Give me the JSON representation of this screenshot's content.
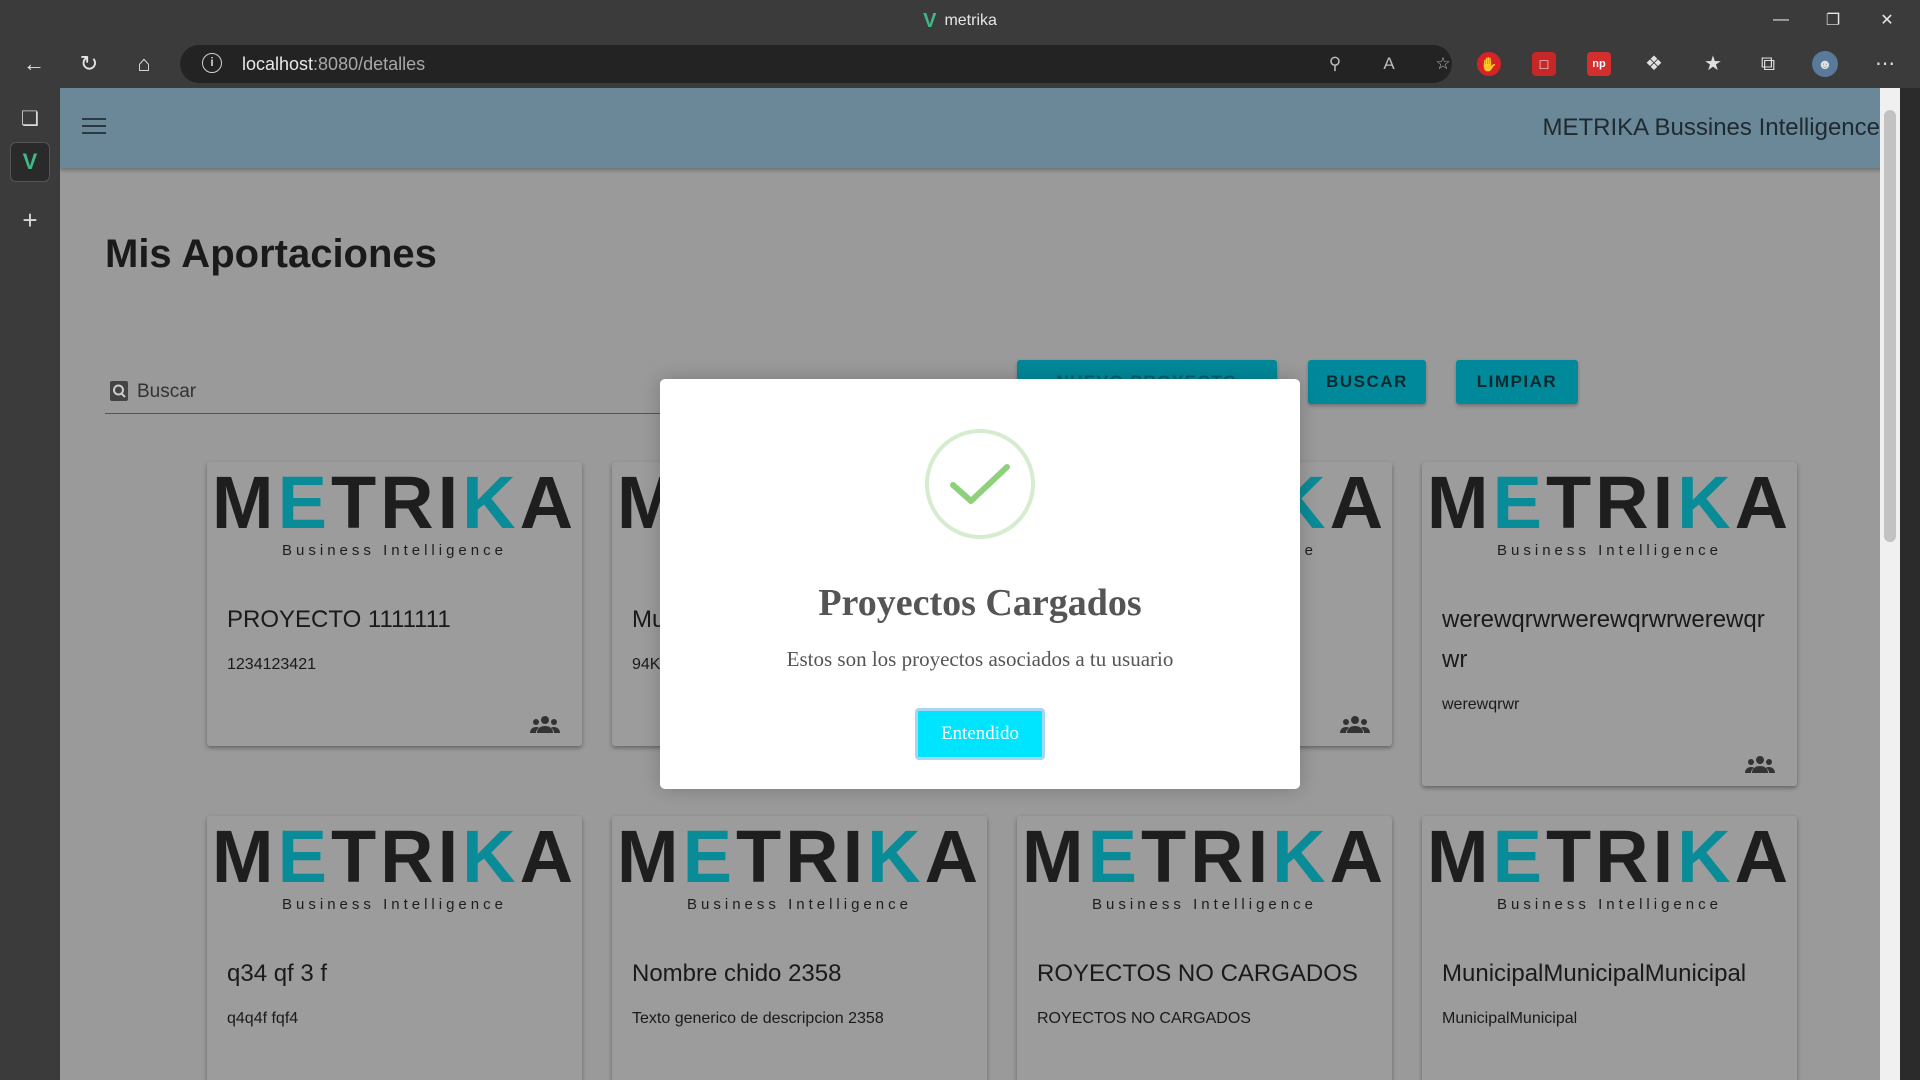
{
  "browser": {
    "window_title": "metrika",
    "url_host": "localhost",
    "url_rest": ":8080/detalles"
  },
  "app": {
    "title": "METRIKA Bussines Intelligence"
  },
  "page": {
    "heading": "Mis Aportaciones",
    "search_placeholder": "Buscar",
    "buttons": {
      "new_project": "NUEVO PROYECTO",
      "search": "BUSCAR",
      "clear": "LIMPIAR"
    }
  },
  "logo": {
    "word": "METRIKA",
    "subtitle": "Business Intelligence"
  },
  "cards": [
    {
      "name": "PROYECTO 1111111",
      "description": "1234123421"
    },
    {
      "name": "Mu",
      "description": "94K"
    },
    {
      "name": "",
      "description": ""
    },
    {
      "name": "werewqrwrwerewqrwrwerewqrwr",
      "description": "werewqrwr"
    },
    {
      "name": "q34 qf 3 f",
      "description": "q4q4f fqf4"
    },
    {
      "name": "Nombre chido 2358",
      "description": "Texto generico de descripcion 2358"
    },
    {
      "name": "ROYECTOS NO CARGADOS",
      "description": "ROYECTOS NO CARGADOS"
    },
    {
      "name": "MunicipalMunicipalMunicipal",
      "description": "MunicipalMunicipal"
    }
  ],
  "modal": {
    "title": "Proyectos Cargados",
    "text": "Estos son los proyectos asociados a tu usuario",
    "button": "Entendido"
  },
  "colors": {
    "accent": "#00899a",
    "app_bar": "#6a8898",
    "modal_button": "#00e5ff",
    "check": "#8fd07a"
  }
}
